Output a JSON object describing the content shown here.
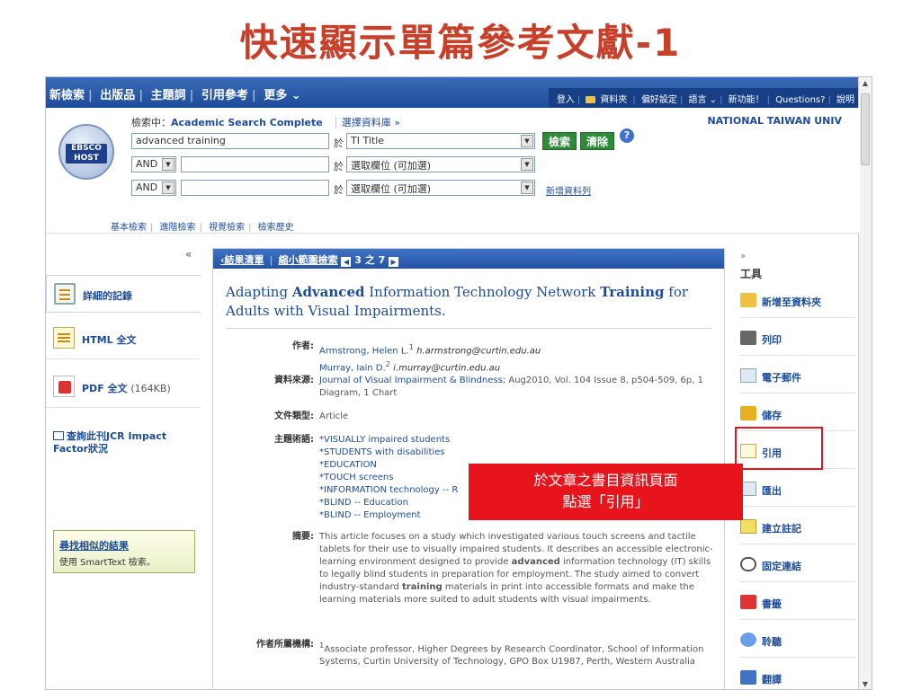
{
  "slide_title": "快速顯示單篇參考文獻-1",
  "topnav": {
    "items": [
      "新檢索",
      "出版品",
      "主題詞",
      "引用參考",
      "更多 ⌄"
    ]
  },
  "util": {
    "items": [
      "登入",
      "資料夾",
      "偏好設定",
      "語言 ⌄",
      "新功能！",
      "Questions?",
      "說明"
    ]
  },
  "search": {
    "searching_label": "檢索中：",
    "database": "Academic Search Complete",
    "choose_db": "選擇資料庫 »",
    "institution": "NATIONAL TAIWAN UNIV",
    "logo_text": "EBSCO HOST",
    "term1": "advanced training",
    "in_label": "於",
    "field1": "TI Title",
    "bool2": "AND",
    "bool3": "AND",
    "field_placeholder": "選取欄位 (可加選)",
    "search_btn": "檢索",
    "clear_btn": "清除",
    "help": "?",
    "add_row": "新增資料列",
    "modes": [
      "基本檢索",
      "進階檢索",
      "視覺檢索",
      "檢索歷史"
    ]
  },
  "left": {
    "collapse": "«",
    "detailed": "詳細的記錄",
    "html": "HTML 全文",
    "pdf": "PDF 全文",
    "pdf_size": "(164KB)",
    "jcr": "查詢此刊JCR Impact Factor狀況",
    "similar_title": "尋找相似的結果",
    "similar_sub": "使用 SmartText 檢索。"
  },
  "main": {
    "results": "‹結果清單",
    "refine": "縮小範圍檢索",
    "page": "3 之 7",
    "title_p1": "Adapting ",
    "title_b1": "Advanced",
    "title_p2": " Information Technology Network ",
    "title_b2": "Training",
    "title_p3": " for Adults with Visual Impairments.",
    "authors_label": "作者:",
    "author1": "Armstrong, Helen L.",
    "author1_sup": "1",
    "author1_email": "h.armstrong@curtin.edu.au",
    "author2": "Murray, Iain D.",
    "author2_sup": "2",
    "author2_email": "i.murray@curtin.edu.au",
    "source_label": "資料來源:",
    "source_journal": "Journal of Visual Impairment & Blindness",
    "source_rest": "; Aug2010, Vol. 104 Issue 8, p504-509, 6p, 1 Diagram, 1 Chart",
    "doctype_label": "文件類型:",
    "doctype": "Article",
    "subjects_label": "主題術語:",
    "subjects": [
      "*VISUALLY impaired students",
      "*STUDENTS with disabilities",
      "*EDUCATION",
      "*TOUCH screens",
      "*INFORMATION technology -- R",
      "*BLIND -- Education",
      "*BLIND -- Employment"
    ],
    "abstract_label": "摘要:",
    "abstract_a": "This article focuses on a study which investigated various touch screens and tactile tablets for their use to visually impaired students. It describes an accessible electronic-learning environment designed to provide ",
    "abstract_b1": "advanced",
    "abstract_c": " information technology (IT) skills to legally blind students in preparation for employment. The study aimed to convert industry-standard ",
    "abstract_b2": "training",
    "abstract_d": " materials in print into accessible formats and make the learning materials more suited to adult students with visual impairments.",
    "affil_label": "作者所屬機構:",
    "affil_sup": "1",
    "affil": "Associate professor, Higher Degrees by Research Coordinator, School of Information Systems, Curtin University of Technology, GPO Box U1987, Perth, Western Australia"
  },
  "callout": {
    "line1": "於文章之書目資訊頁面",
    "line2": "點選「引用」"
  },
  "right": {
    "collapse": "»",
    "tools_label": "工具",
    "tools": [
      "新增至資料夾",
      "列印",
      "電子郵件",
      "儲存",
      "引用",
      "匯出",
      "建立註記",
      "固定連結",
      "書籤",
      "聆聽",
      "翻譯"
    ]
  },
  "colors": {
    "title_red": "#c8402a",
    "brand_blue": "#1d4c9a",
    "highlight_red": "#e8141b",
    "search_green": "#2f8a3a"
  }
}
